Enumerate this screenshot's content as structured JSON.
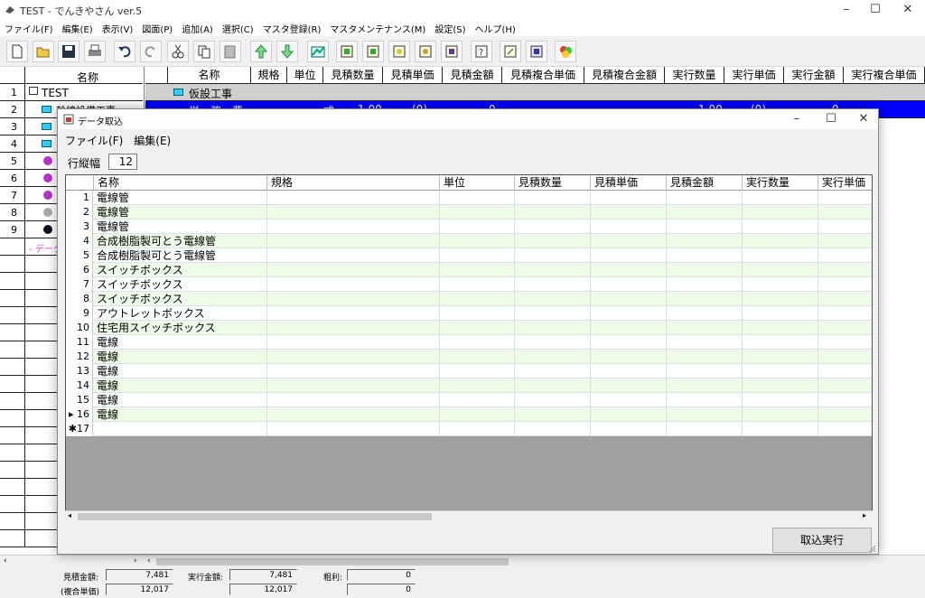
{
  "app": {
    "title": "TEST - でんきやさん ver.5"
  },
  "menu": [
    "ファイル(F)",
    "編集(E)",
    "表示(V)",
    "図面(P)",
    "追加(A)",
    "選択(C)",
    "マスタ登録(R)",
    "マスタメンテナンス(M)",
    "設定(S)",
    "ヘルプ(H)"
  ],
  "tree": {
    "header": "名称",
    "rows": [
      {
        "num": "1",
        "label": "TEST"
      },
      {
        "num": "2",
        "label": "幹線設備工事"
      },
      {
        "num": "3",
        "label": ""
      },
      {
        "num": "4",
        "label": ""
      },
      {
        "num": "5",
        "label": ""
      },
      {
        "num": "6",
        "label": ""
      },
      {
        "num": "7",
        "label": ""
      },
      {
        "num": "8",
        "label": ""
      },
      {
        "num": "9",
        "label": ""
      }
    ],
    "extra": "- データ"
  },
  "main_grid": {
    "headers": [
      "名称",
      "規格",
      "単位",
      "見積数量",
      "見積単価",
      "見積金額",
      "見積複合単価",
      "見積複合金額",
      "実行数量",
      "実行単価",
      "実行金額",
      "実行複合単価"
    ],
    "row1": "仮設工事",
    "row2": [
      "労　務　費",
      "",
      "式",
      "1.00",
      "(0)",
      "0",
      "",
      "",
      "1.00",
      "(0)",
      "0",
      ""
    ]
  },
  "status": {
    "est_label": "見積金額:",
    "est_value": "7,481",
    "exec_label": "実行金額:",
    "exec_value": "7,481",
    "profit_label": "粗利:",
    "profit_value": "0",
    "composite_label": "(複合単価)",
    "composite_est": "12,017",
    "composite_exec": "12,017",
    "composite_profit": "0"
  },
  "dialog": {
    "title": "データ取込",
    "menu": [
      "ファイル(F)",
      "編集(E)"
    ],
    "row_height_label": "行縦幅",
    "row_height_value": "12",
    "headers": [
      "名称",
      "規格",
      "単位",
      "見積数量",
      "見積単価",
      "見積金額",
      "実行数量",
      "実行単価"
    ],
    "rows": [
      {
        "num": "1",
        "name": "電線管"
      },
      {
        "num": "2",
        "name": "電線管"
      },
      {
        "num": "3",
        "name": "電線管"
      },
      {
        "num": "4",
        "name": "合成樹脂製可とう電線管"
      },
      {
        "num": "5",
        "name": "合成樹脂製可とう電線管"
      },
      {
        "num": "6",
        "name": "スイッチボックス"
      },
      {
        "num": "7",
        "name": "スイッチボックス"
      },
      {
        "num": "8",
        "name": "スイッチボックス"
      },
      {
        "num": "9",
        "name": "アウトレットボックス"
      },
      {
        "num": "10",
        "name": "住宅用スイッチボックス"
      },
      {
        "num": "11",
        "name": "電線"
      },
      {
        "num": "12",
        "name": "電線"
      },
      {
        "num": "13",
        "name": "電線"
      },
      {
        "num": "14",
        "name": "電線"
      },
      {
        "num": "15",
        "name": "電線"
      },
      {
        "num": "▸ 16",
        "name": "電線"
      },
      {
        "num": "✱17",
        "name": ""
      }
    ],
    "exec_button": "取込実行"
  },
  "colors": {
    "selection": "#0000ff",
    "row_alt": "#eefbe8",
    "grid_empty": "#a0a0a0"
  }
}
